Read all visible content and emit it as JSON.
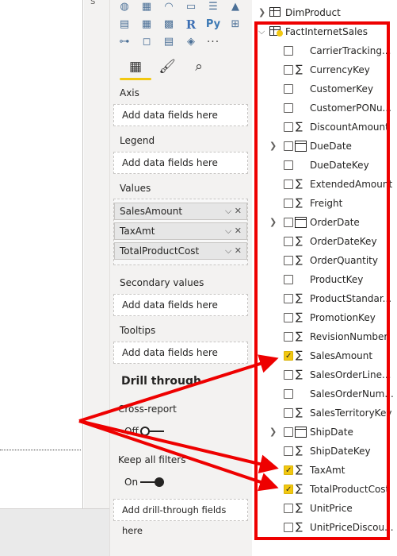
{
  "canvas": {
    "side_label": "S"
  },
  "viz_icons": [
    {
      "name": "map-icon",
      "glyph": "◍"
    },
    {
      "name": "table-grid-icon",
      "glyph": "▦"
    },
    {
      "name": "gauge-icon",
      "glyph": "◠"
    },
    {
      "name": "card-icon",
      "glyph": "▭"
    },
    {
      "name": "multirow-card-icon",
      "glyph": "☰"
    },
    {
      "name": "kpi-icon",
      "glyph": "▲"
    },
    {
      "name": "slicer-icon",
      "glyph": "▤"
    },
    {
      "name": "table-icon",
      "glyph": "▦"
    },
    {
      "name": "matrix-icon",
      "glyph": "▩"
    },
    {
      "name": "r-visual-icon",
      "glyph": "R"
    },
    {
      "name": "python-visual-icon",
      "glyph": "Py"
    },
    {
      "name": "key-influencers-icon",
      "glyph": "⊞"
    },
    {
      "name": "decomposition-tree-icon",
      "glyph": "⊶"
    },
    {
      "name": "qa-icon",
      "glyph": "◻"
    },
    {
      "name": "narrative-icon",
      "glyph": "▤"
    },
    {
      "name": "power-apps-icon",
      "glyph": "◈"
    },
    {
      "name": "more-visuals-icon",
      "glyph": "···"
    }
  ],
  "tabs": [
    {
      "name": "fields-tab-icon",
      "glyph": "▦"
    },
    {
      "name": "format-tab-icon",
      "glyph": "🖌"
    },
    {
      "name": "analytics-tab-icon",
      "glyph": "⌕"
    }
  ],
  "viz_pane": {
    "axis_label": "Axis",
    "legend_label": "Legend",
    "values_label": "Values",
    "secondary_label": "Secondary values",
    "tooltips_label": "Tooltips",
    "placeholder": "Add data fields here",
    "values": [
      "SalesAmount",
      "TaxAmt",
      "TotalProductCost"
    ],
    "value_controls": "⌵ ✕",
    "drill_title": "Drill through",
    "cross_report_label": "Cross-report",
    "cross_report_state": "Off",
    "keep_filters_label": "Keep all filters",
    "keep_filters_state": "On",
    "drill_placeholder": "Add drill-through fields here"
  },
  "fields_pane": {
    "tables": [
      {
        "name": "DimProduct",
        "expanded": false
      },
      {
        "name": "FactInternetSales",
        "expanded": true
      }
    ],
    "fields": [
      {
        "name": "CarrierTracking...",
        "sigma": false,
        "checked": false,
        "date": false
      },
      {
        "name": "CurrencyKey",
        "sigma": true,
        "checked": false,
        "date": false
      },
      {
        "name": "CustomerKey",
        "sigma": false,
        "checked": false,
        "date": false
      },
      {
        "name": "CustomerPONu...",
        "sigma": false,
        "checked": false,
        "date": false
      },
      {
        "name": "DiscountAmount",
        "sigma": true,
        "checked": false,
        "date": false
      },
      {
        "name": "DueDate",
        "sigma": false,
        "checked": false,
        "date": true
      },
      {
        "name": "DueDateKey",
        "sigma": false,
        "checked": false,
        "date": false
      },
      {
        "name": "ExtendedAmount",
        "sigma": true,
        "checked": false,
        "date": false
      },
      {
        "name": "Freight",
        "sigma": true,
        "checked": false,
        "date": false
      },
      {
        "name": "OrderDate",
        "sigma": false,
        "checked": false,
        "date": true
      },
      {
        "name": "OrderDateKey",
        "sigma": true,
        "checked": false,
        "date": false
      },
      {
        "name": "OrderQuantity",
        "sigma": true,
        "checked": false,
        "date": false
      },
      {
        "name": "ProductKey",
        "sigma": false,
        "checked": false,
        "date": false
      },
      {
        "name": "ProductStandar...",
        "sigma": true,
        "checked": false,
        "date": false
      },
      {
        "name": "PromotionKey",
        "sigma": true,
        "checked": false,
        "date": false
      },
      {
        "name": "RevisionNumber",
        "sigma": true,
        "checked": false,
        "date": false
      },
      {
        "name": "SalesAmount",
        "sigma": true,
        "checked": true,
        "date": false
      },
      {
        "name": "SalesOrderLine...",
        "sigma": true,
        "checked": false,
        "date": false
      },
      {
        "name": "SalesOrderNum...",
        "sigma": false,
        "checked": false,
        "date": false
      },
      {
        "name": "SalesTerritoryKey",
        "sigma": true,
        "checked": false,
        "date": false
      },
      {
        "name": "ShipDate",
        "sigma": false,
        "checked": false,
        "date": true
      },
      {
        "name": "ShipDateKey",
        "sigma": true,
        "checked": false,
        "date": false
      },
      {
        "name": "TaxAmt",
        "sigma": true,
        "checked": true,
        "date": false
      },
      {
        "name": "TotalProductCost",
        "sigma": true,
        "checked": true,
        "date": false
      },
      {
        "name": "UnitPrice",
        "sigma": true,
        "checked": false,
        "date": false
      },
      {
        "name": "UnitPriceDiscou...",
        "sigma": true,
        "checked": false,
        "date": false
      }
    ]
  },
  "colors": {
    "annotation_red": "#ee0000",
    "accent_yellow": "#f2c811",
    "pane_bg": "#f3f2f1"
  }
}
